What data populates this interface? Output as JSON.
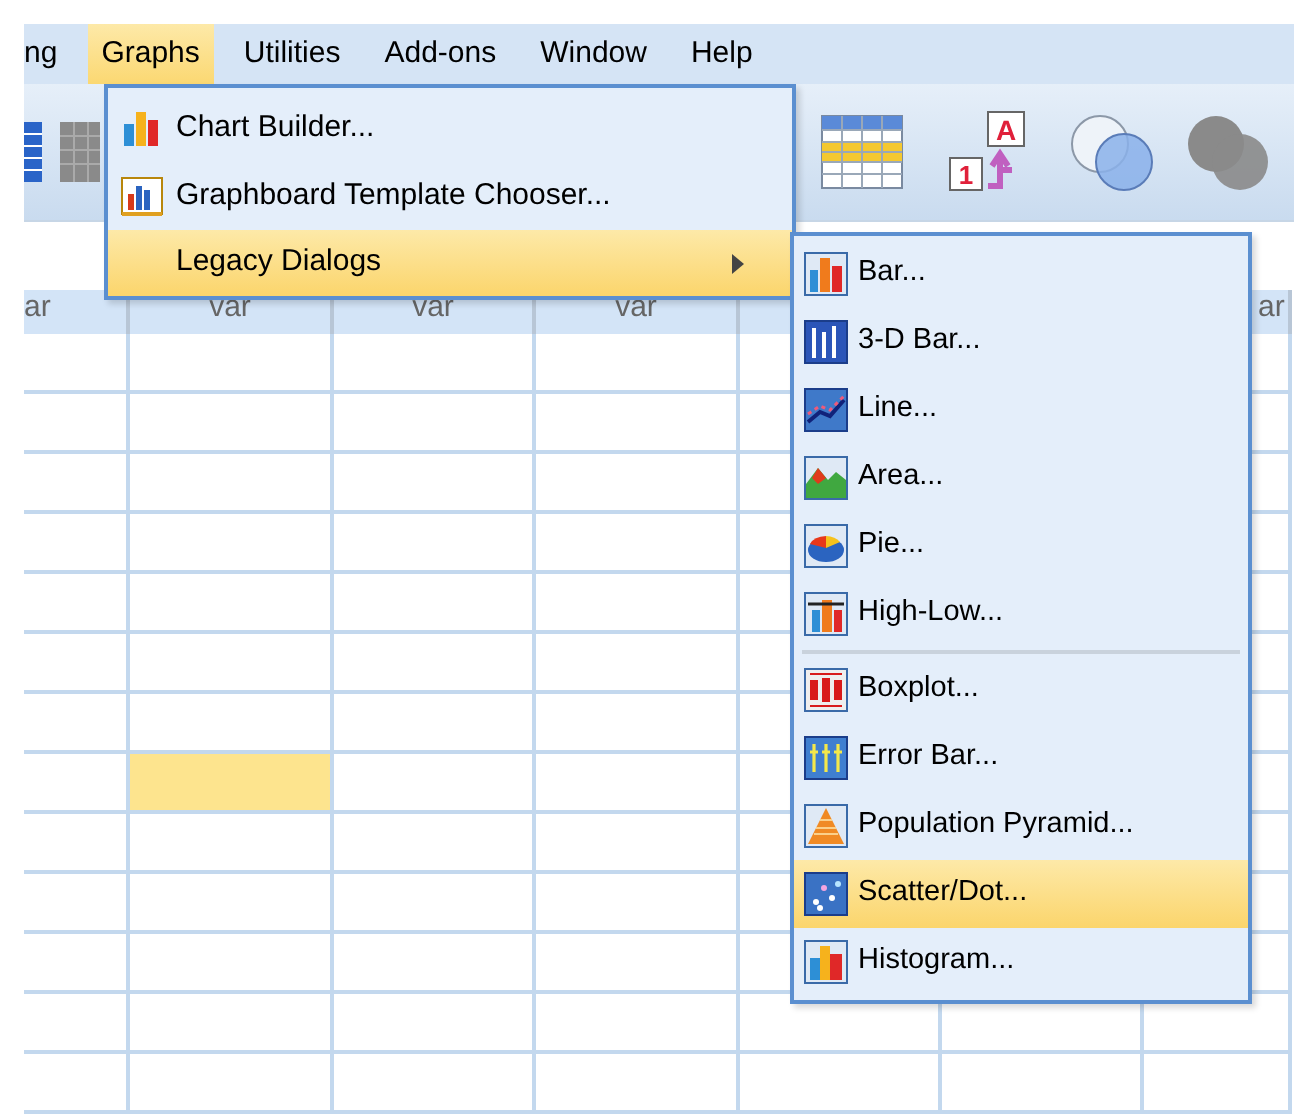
{
  "menu_bar": [
    {
      "label": "ng",
      "selected": false
    },
    {
      "label": "Graphs",
      "selected": true
    },
    {
      "label": "Utilities",
      "selected": false
    },
    {
      "label": "Add-ons",
      "selected": false
    },
    {
      "label": "Window",
      "selected": false
    },
    {
      "label": "Help",
      "selected": false
    }
  ],
  "toolbar": [
    {
      "kind": "plain"
    },
    {
      "kind": "plain"
    },
    {
      "kind": "plain"
    },
    {
      "kind": "labels",
      "labels": [
        "A",
        "1"
      ]
    },
    {
      "kind": "plain"
    },
    {
      "kind": "plain"
    }
  ],
  "graphs_menu": [
    {
      "label": "Chart Builder...",
      "selected": false,
      "submenu": false
    },
    {
      "label": "Graphboard Template Chooser...",
      "selected": false,
      "submenu": false
    },
    {
      "label": "Legacy Dialogs",
      "selected": true,
      "submenu": true
    }
  ],
  "legacy_dialogs_menu": [
    {
      "kind": "item",
      "label": "Bar...",
      "selected": false
    },
    {
      "kind": "item",
      "label": "3-D Bar...",
      "selected": false
    },
    {
      "kind": "item",
      "label": "Line...",
      "selected": false
    },
    {
      "kind": "item",
      "label": "Area...",
      "selected": false
    },
    {
      "kind": "item",
      "label": "Pie...",
      "selected": false
    },
    {
      "kind": "item",
      "label": "High-Low...",
      "selected": false
    },
    {
      "kind": "separator"
    },
    {
      "kind": "item",
      "label": "Boxplot...",
      "selected": false
    },
    {
      "kind": "item",
      "label": "Error Bar...",
      "selected": false
    },
    {
      "kind": "item",
      "label": "Population Pyramid...",
      "selected": false
    },
    {
      "kind": "item",
      "label": "Scatter/Dot...",
      "selected": true
    },
    {
      "kind": "item",
      "label": "Histogram...",
      "selected": false
    }
  ],
  "grid": {
    "columns": [
      {
        "header": "ar"
      },
      {
        "header": "var"
      },
      {
        "header": "var"
      },
      {
        "header": "var"
      },
      {},
      {},
      {
        "header": "ar"
      }
    ],
    "rows": [
      {
        "cells": [
          {
            "selected": false
          },
          {
            "selected": false
          },
          {
            "selected": false
          },
          {
            "selected": false
          },
          {
            "selected": false
          },
          {},
          {
            "selected": false
          }
        ]
      },
      {
        "cells": [
          {
            "selected": false
          },
          {
            "selected": false
          },
          {
            "selected": false
          },
          {
            "selected": false
          },
          {
            "selected": false
          },
          {},
          {
            "selected": false
          }
        ]
      },
      {
        "cells": [
          {
            "selected": false
          },
          {
            "selected": false
          },
          {
            "selected": false
          },
          {
            "selected": false
          },
          {
            "selected": false
          },
          {},
          {
            "selected": false
          }
        ]
      },
      {
        "cells": [
          {
            "selected": false
          },
          {
            "selected": false
          },
          {
            "selected": false
          },
          {
            "selected": false
          },
          {
            "selected": false
          },
          {},
          {
            "selected": false
          }
        ]
      },
      {
        "cells": [
          {
            "selected": false
          },
          {
            "selected": false
          },
          {
            "selected": false
          },
          {
            "selected": false
          },
          {
            "selected": false
          },
          {},
          {
            "selected": false
          }
        ]
      },
      {
        "cells": [
          {
            "selected": false
          },
          {
            "selected": false
          },
          {
            "selected": false
          },
          {
            "selected": false
          },
          {
            "selected": false
          },
          {},
          {
            "selected": false
          }
        ]
      },
      {
        "cells": [
          {
            "selected": false
          },
          {
            "selected": false
          },
          {
            "selected": false
          },
          {
            "selected": false
          },
          {
            "selected": false
          },
          {},
          {
            "selected": false
          }
        ]
      },
      {
        "cells": [
          {
            "selected": false
          },
          {
            "selected": true
          },
          {
            "selected": false
          },
          {
            "selected": false
          },
          {
            "selected": false
          },
          {},
          {
            "selected": false
          }
        ]
      },
      {
        "cells": [
          {
            "selected": false
          },
          {
            "selected": false
          },
          {
            "selected": false
          },
          {
            "selected": false
          },
          {
            "selected": false
          },
          {},
          {
            "selected": false
          }
        ]
      },
      {
        "cells": [
          {
            "selected": false
          },
          {
            "selected": false
          },
          {
            "selected": false
          },
          {
            "selected": false
          },
          {
            "selected": false
          },
          {},
          {
            "selected": false
          }
        ]
      },
      {
        "cells": [
          {
            "selected": false
          },
          {
            "selected": false
          },
          {
            "selected": false
          },
          {
            "selected": false
          },
          {
            "selected": false
          },
          {},
          {
            "selected": false
          }
        ]
      },
      {
        "cells": [
          {
            "selected": false
          },
          {
            "selected": false
          },
          {
            "selected": false
          },
          {
            "selected": false
          },
          {
            "selected": false
          },
          {
            "selected": false
          },
          {
            "selected": false
          }
        ]
      },
      {
        "cells": [
          {
            "selected": false
          },
          {
            "selected": false
          },
          {
            "selected": false
          },
          {
            "selected": false
          },
          {
            "selected": false
          },
          {
            "selected": false
          },
          {
            "selected": false
          }
        ]
      }
    ]
  }
}
